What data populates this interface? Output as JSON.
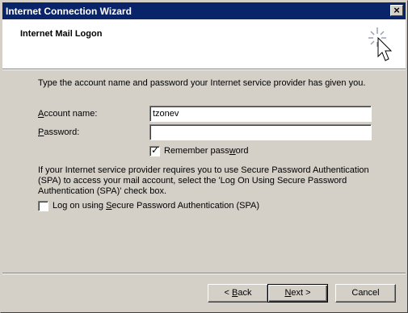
{
  "window": {
    "title": "Internet Connection Wizard",
    "close_glyph": "✕"
  },
  "header": {
    "title": "Internet Mail Logon",
    "icon": "wizard-cursor-icon"
  },
  "intro": "Type the account name and password your Internet service provider has given you.",
  "account": {
    "label_prefix": "",
    "label_access": "A",
    "label_rest": "ccount name:",
    "value": "tzonev"
  },
  "password": {
    "label_access": "P",
    "label_rest": "assword:",
    "value": ""
  },
  "remember": {
    "label_pre": "Remember pass",
    "label_access": "w",
    "label_post": "ord",
    "checked": true
  },
  "spa_text": "If your Internet service provider requires you to use Secure Password Authentication (SPA) to access your mail account, select the 'Log On Using Secure Password Authentication (SPA)' check box.",
  "spa_check": {
    "label_pre": "Log on using ",
    "label_access": "S",
    "label_post": "ecure Password Authentication (SPA)",
    "checked": false
  },
  "buttons": {
    "back": {
      "pre": "< ",
      "access": "B",
      "post": "ack"
    },
    "next": {
      "pre": "",
      "access": "N",
      "post": "ext >"
    },
    "cancel": "Cancel"
  },
  "colors": {
    "titlebar": "#0a246a",
    "face": "#d4d0c8"
  }
}
